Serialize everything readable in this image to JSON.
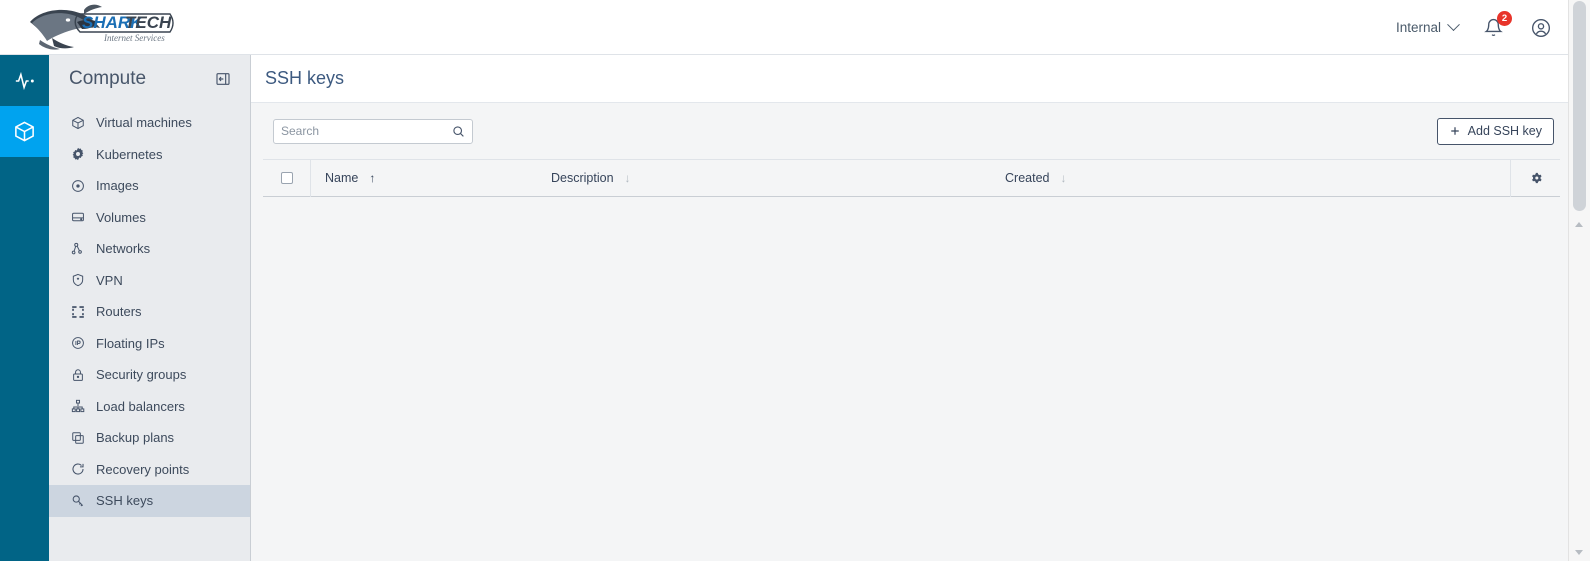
{
  "header": {
    "logo_main": "SHARK",
    "logo_accent": "TECH",
    "logo_tagline": "Internet Services",
    "tenant_label": "Internal",
    "notifications_count": "2",
    "notification_icon": "bell-icon",
    "account_icon": "user-circle-icon",
    "chevron_icon": "chevron-down-icon"
  },
  "rail": {
    "items": [
      {
        "icon": "activity-pulse-icon",
        "active": false
      },
      {
        "icon": "cube-icon",
        "active": true
      }
    ]
  },
  "sidebar": {
    "title": "Compute",
    "collapse_icon": "collapse-panel-icon",
    "items": [
      {
        "label": "Virtual machines",
        "icon": "cube-icon"
      },
      {
        "label": "Kubernetes",
        "icon": "kubernetes-wheel-icon"
      },
      {
        "label": "Images",
        "icon": "disc-icon"
      },
      {
        "label": "Volumes",
        "icon": "drive-icon"
      },
      {
        "label": "Networks",
        "icon": "network-nodes-icon"
      },
      {
        "label": "VPN",
        "icon": "shield-icon"
      },
      {
        "label": "Routers",
        "icon": "router-icon"
      },
      {
        "label": "Floating IPs",
        "icon": "floating-ip-icon"
      },
      {
        "label": "Security groups",
        "icon": "lock-icon"
      },
      {
        "label": "Load balancers",
        "icon": "load-balancer-icon"
      },
      {
        "label": "Backup plans",
        "icon": "copy-icon"
      },
      {
        "label": "Recovery points",
        "icon": "restore-icon"
      },
      {
        "label": "SSH keys",
        "icon": "key-icon"
      }
    ],
    "active_item": "SSH keys"
  },
  "main": {
    "page_title": "SSH keys",
    "search": {
      "placeholder": "Search",
      "value": "",
      "icon": "search-icon"
    },
    "add_button": {
      "label": "Add SSH key",
      "icon": "plus-icon"
    },
    "table": {
      "columns": [
        {
          "label": "Name",
          "sort": "asc",
          "sort_icon": "arrow-up-icon"
        },
        {
          "label": "Description",
          "sort": "desc",
          "sort_icon": "arrow-down-icon"
        },
        {
          "label": "Created",
          "sort": "desc",
          "sort_icon": "arrow-down-icon"
        }
      ],
      "select_all_checkbox": "unchecked",
      "settings_icon": "gear-icon",
      "rows": []
    }
  },
  "colors": {
    "rail_bg": "#016486",
    "rail_active": "#00a3ef",
    "sidebar_bg": "#e9ebee",
    "sidebar_active": "#ccd5e0",
    "title_blue": "#3d5a80",
    "badge_red": "#e8342a",
    "logo_blue": "#1b6fb5"
  }
}
